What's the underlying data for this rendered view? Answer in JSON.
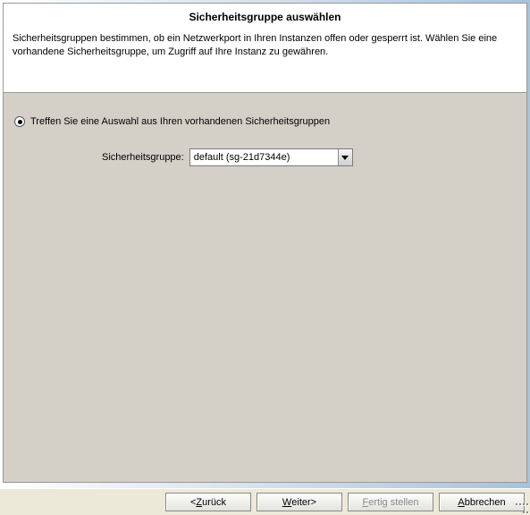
{
  "header": {
    "title": "Sicherheitsgruppe auswählen",
    "description": "Sicherheitsgruppen bestimmen, ob ein Netzwerkport in Ihren Instanzen offen oder gesperrt ist. Wählen Sie eine vorhandene Sicherheitsgruppe, um Zugriff auf Ihre Instanz zu gewähren."
  },
  "form": {
    "radio_existing_label": "Treffen Sie eine Auswahl aus Ihren vorhandenen Sicherheitsgruppen",
    "field_label": "Sicherheitsgruppe:",
    "select_value": "default (sg-21d7344e)"
  },
  "buttons": {
    "back_pre": "Z",
    "back_rest": "urück",
    "next_pre": "W",
    "next_rest": "eiter",
    "finish_pre": "F",
    "finish_rest": "ertig stellen",
    "cancel_pre": "A",
    "cancel_rest": "bbrechen"
  }
}
